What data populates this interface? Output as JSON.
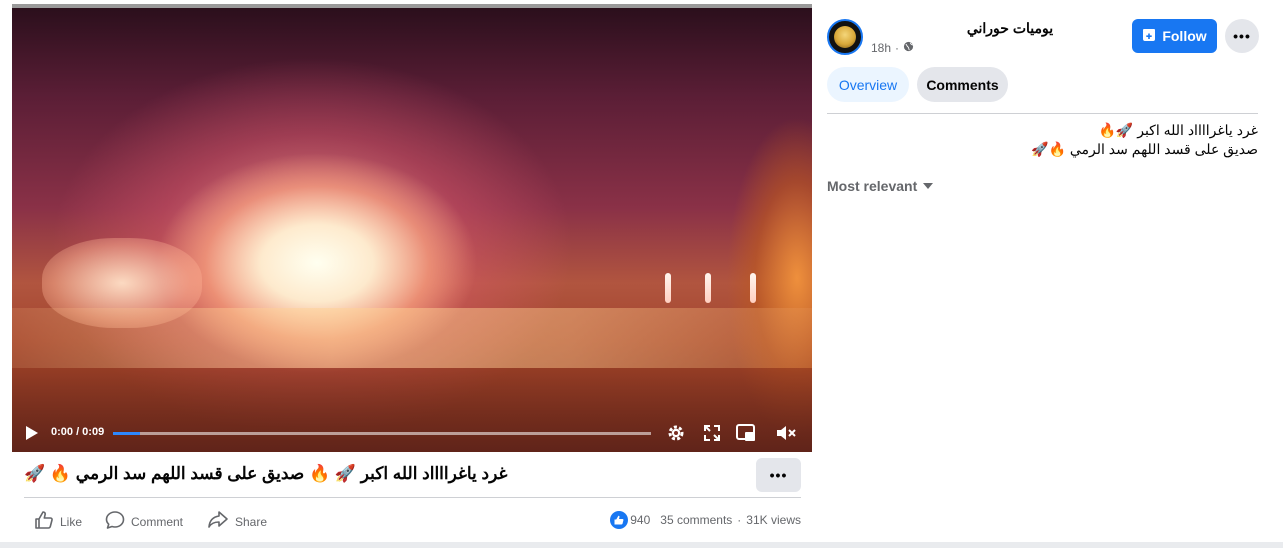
{
  "video": {
    "time": "0:00 / 0:09",
    "progress_fraction": 0.05
  },
  "post": {
    "title": "غرد ياغرااااد الله اكبر 🚀 🔥 صديق على قسد اللهم سد الرمي 🔥 🚀",
    "more_label": "•••"
  },
  "actions": {
    "like": "Like",
    "comment": "Comment",
    "share": "Share"
  },
  "stats": {
    "reactions": "940",
    "comments": "35 comments",
    "separator": "·",
    "views": "31K views"
  },
  "sidebar": {
    "page_name": "يوميات حوراني",
    "time": "18h",
    "dot": "·",
    "follow_label": "Follow",
    "options_label": "•••",
    "tabs": [
      {
        "label": "Overview",
        "active": true
      },
      {
        "label": "Comments",
        "active": false
      }
    ],
    "caption_lines": [
      "غرد ياغرااااد الله اكبر 🚀🔥",
      "صديق على قسد اللهم سد الرمي 🔥🚀"
    ],
    "sort_label": "Most relevant"
  },
  "icons": {
    "play": "play-icon",
    "settings": "gear-icon",
    "fullscreen": "fullscreen-icon",
    "pip": "picture-in-picture-icon",
    "mute": "volume-muted-icon",
    "like": "thumbs-up-icon",
    "comment": "speech-bubble-icon",
    "share": "share-arrow-icon",
    "globe": "globe-icon",
    "follow": "add-page-icon"
  },
  "colors": {
    "accent": "#1877f2",
    "secondary_text": "#65676b",
    "button_bg": "#e4e6eb"
  }
}
